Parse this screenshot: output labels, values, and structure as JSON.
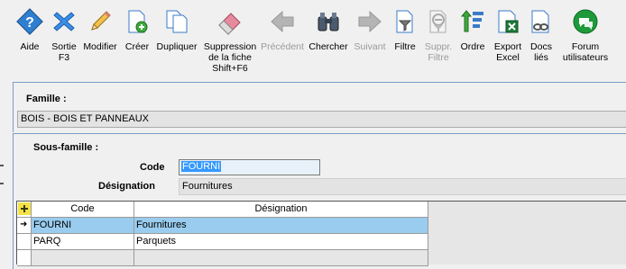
{
  "toolbar": {
    "buttons": [
      {
        "id": "aide",
        "label": "Aide",
        "icon": "help-diamond-icon",
        "enabled": true
      },
      {
        "id": "sortie",
        "label": "Sortie\nF3",
        "icon": "close-x-icon",
        "enabled": true
      },
      {
        "id": "modifier",
        "label": "Modifier",
        "icon": "pencil-icon",
        "enabled": true
      },
      {
        "id": "creer",
        "label": "Créer",
        "icon": "new-document-icon",
        "enabled": true
      },
      {
        "id": "dupliquer",
        "label": "Dupliquer",
        "icon": "duplicate-icon",
        "enabled": true
      },
      {
        "id": "suppression",
        "label": "Suppression\nde la fiche\nShift+F6",
        "icon": "eraser-icon",
        "enabled": true
      },
      {
        "id": "precedent",
        "label": "Précédent",
        "icon": "arrow-left-icon",
        "enabled": false
      },
      {
        "id": "chercher",
        "label": "Chercher",
        "icon": "binoculars-icon",
        "enabled": true
      },
      {
        "id": "suivant",
        "label": "Suivant",
        "icon": "arrow-right-icon",
        "enabled": false
      },
      {
        "id": "filtre",
        "label": "Filtre",
        "icon": "filter-document-icon",
        "enabled": true
      },
      {
        "id": "suppr-filtre",
        "label": "Suppr.\nFiltre",
        "icon": "remove-filter-icon",
        "enabled": false
      },
      {
        "id": "ordre",
        "label": "Ordre",
        "icon": "sort-order-icon",
        "enabled": true
      },
      {
        "id": "export-excel",
        "label": "Export\nExcel",
        "icon": "excel-export-icon",
        "enabled": true
      },
      {
        "id": "docs-lies",
        "label": "Docs\nliés",
        "icon": "linked-docs-icon",
        "enabled": true
      },
      {
        "id": "forum",
        "label": "Forum\nutilisateurs",
        "icon": "forum-chat-icon",
        "enabled": true
      }
    ]
  },
  "famille": {
    "title": "Famille :",
    "value": "BOIS - BOIS ET PANNEAUX"
  },
  "sous_famille": {
    "title": "Sous-famille :",
    "code_label": "Code",
    "code_value": "FOURNI",
    "designation_label": "Désignation",
    "designation_value": "Fournitures"
  },
  "grid": {
    "headers": {
      "code": "Code",
      "designation": "Désignation"
    },
    "rows": [
      {
        "code": "FOURNI",
        "designation": "Fournitures",
        "selected": true
      },
      {
        "code": "PARQ",
        "designation": "Parquets",
        "selected": false
      }
    ],
    "current_row_marker": "➜"
  },
  "colors": {
    "panel_border": "#7a9cc6",
    "selection": "#99ccee",
    "text_highlight": "#3399ff"
  }
}
